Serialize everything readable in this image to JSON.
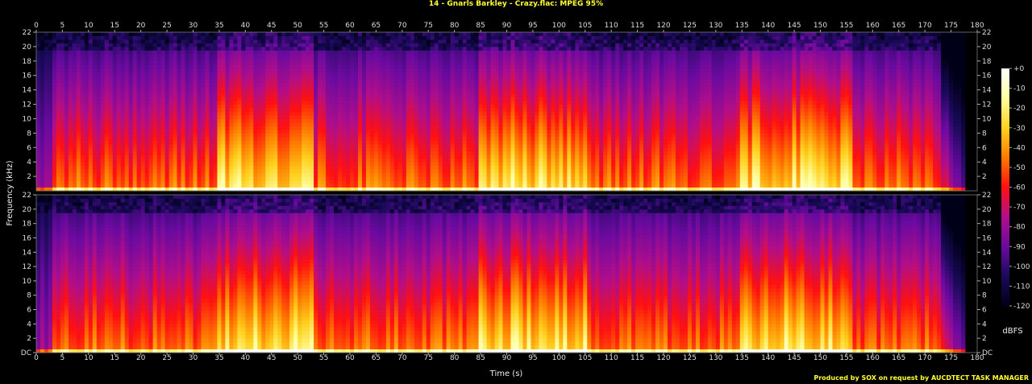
{
  "title": "14 - Gnarls Barkley - Crazy.flac: MPEG 95%",
  "credit": "Produced by SOX on request by AUCDTECT TASK MANAGER",
  "colors": {
    "background": "#000000",
    "title": "#ffff33",
    "axis_text": "#dddddd",
    "palette": [
      "#000018",
      "#1a0a5a",
      "#6a0aa0",
      "#b00e8a",
      "#ff1010",
      "#ff7a00",
      "#ffd21f",
      "#ffffa0",
      "#ffffff"
    ]
  },
  "chart_data": {
    "type": "heatmap",
    "subtype": "stereo spectrogram",
    "channels": [
      "top",
      "bottom"
    ],
    "xlabel": "Time (s)",
    "ylabel": "Frequency (kHz)",
    "xlim": [
      0,
      180
    ],
    "ylim": [
      0,
      22
    ],
    "x_ticks": [
      "0",
      "5",
      "10",
      "15",
      "20",
      "25",
      "30",
      "35",
      "40",
      "45",
      "50",
      "55",
      "60",
      "65",
      "70",
      "75",
      "80",
      "85",
      "90",
      "95",
      "100",
      "105",
      "110",
      "115",
      "120",
      "125",
      "130",
      "135",
      "140",
      "145",
      "150",
      "155",
      "160",
      "165",
      "170",
      "175",
      "180"
    ],
    "y_ticks": [
      "DC",
      "2",
      "4",
      "6",
      "8",
      "10",
      "12",
      "14",
      "16",
      "18",
      "20",
      "22"
    ],
    "colorbar": {
      "label": "dBFS",
      "ticks": [
        "+0",
        "-10",
        "-20",
        "-30",
        "-40",
        "-50",
        "-60",
        "-70",
        "-80",
        "-90",
        "-100",
        "-110",
        "-120"
      ],
      "range": [
        -120,
        0
      ]
    },
    "track_end_s": 178,
    "high_energy_sections_s": [
      [
        35,
        53
      ],
      [
        85,
        105
      ],
      [
        135,
        156
      ]
    ]
  }
}
